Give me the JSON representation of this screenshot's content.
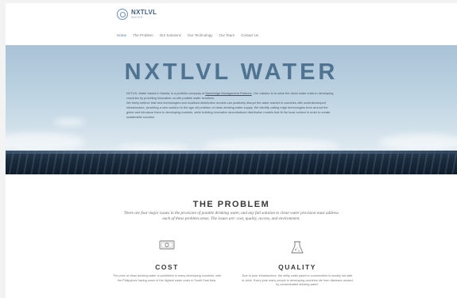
{
  "header": {
    "logo_title": "NXTLVL",
    "logo_sub": "WATER",
    "nav": [
      {
        "label": "Home",
        "active": true
      },
      {
        "label": "The Problem",
        "active": false
      },
      {
        "label": "Our Solutions",
        "active": false
      },
      {
        "label": "Our Technology",
        "active": false
      },
      {
        "label": "Our Team",
        "active": false
      },
      {
        "label": "Contact Us",
        "active": false
      }
    ]
  },
  "hero": {
    "title": "NXTLVL WATER",
    "p1_before": "NXTLVL Water based in Manila, is a portfolio company of ",
    "p1_link": "Bambridge Management Partners",
    "p1_after": ". Our mission is to solve the clean water crisis in developing countries by providing innovative on-site potable water solutions.",
    "p2": "We firmly believe that new technologies and localised distribution models can positively disrupt the water market in countries with underdeveloped infrastructure, providing a new solution to the age old problem of clean drinking water supply. We identify cutting edge technologies from around the globe and introduce them to developing markets, while building innovative decentralised distribution models that fit the local context in order to create sustainable success."
  },
  "problem": {
    "title": "THE PROBLEM",
    "intro": "There are four major issues in the provision of potable drinking water, and any full solution to clean water provision must address each of these problem areas. The issues are: cost, quality, access, and environment.",
    "items": [
      {
        "title": "COST",
        "text": "The price of clean drinking water is prohibitive in many developing countries, with the Philippines having some of the highest water costs in South East Asia."
      },
      {
        "title": "QUALITY",
        "text": "Due to poor infrastructure, the utility water piped to communities is usually not safe to drink. Every year many people in developing countries die from diseases caused by contaminated drinking water."
      }
    ]
  }
}
